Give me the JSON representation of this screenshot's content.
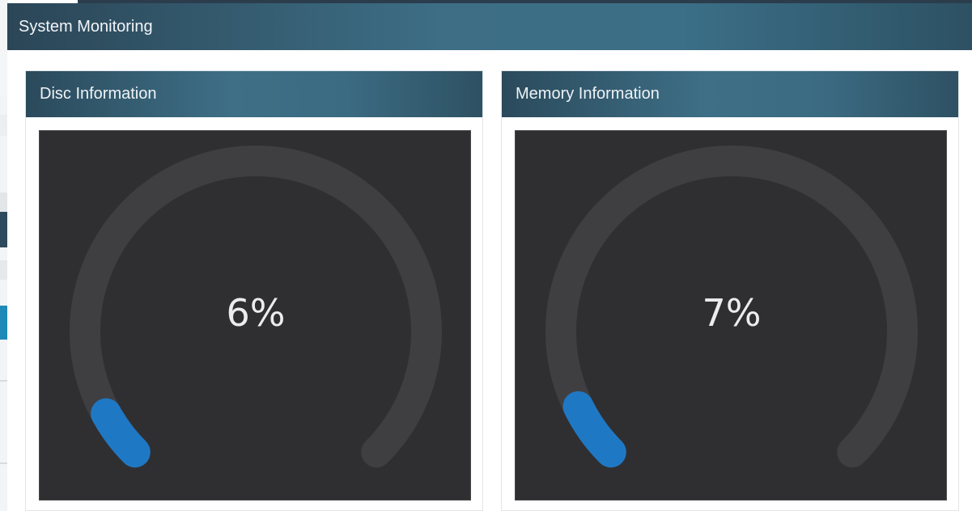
{
  "panel": {
    "title": "System Monitoring"
  },
  "cards": [
    {
      "title": "Disc Information",
      "gauge": {
        "percent": 6,
        "label": "6%"
      }
    },
    {
      "title": "Memory Information",
      "gauge": {
        "percent": 7,
        "label": "7%"
      }
    }
  ],
  "colors": {
    "gauge_track": "#3f3f42",
    "gauge_fill": "#1f78c4",
    "gauge_background": "#2f2f31",
    "header_accent": "#3d6e85"
  }
}
